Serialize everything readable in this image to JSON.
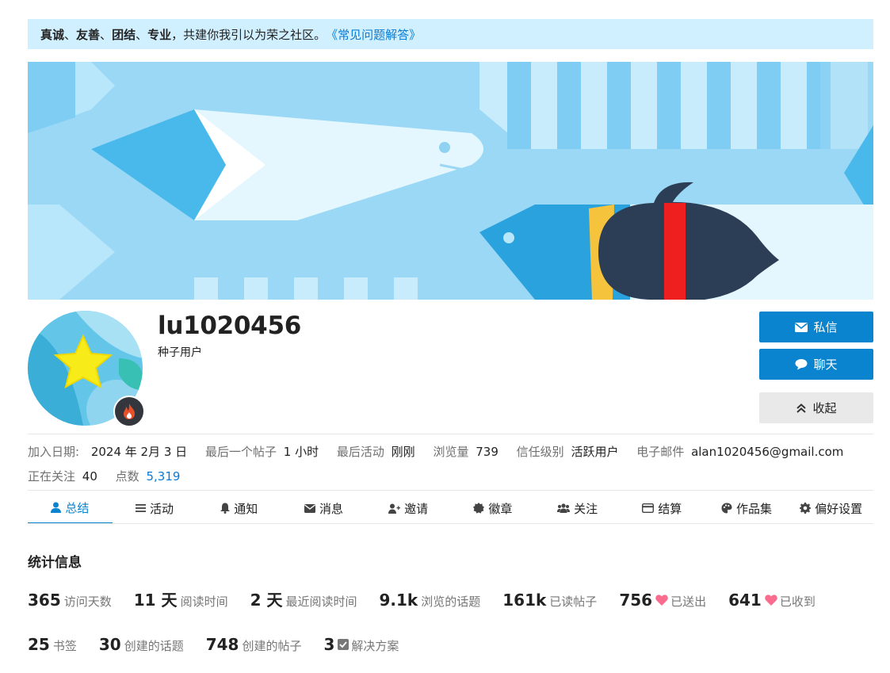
{
  "notice": {
    "bold1": "真诚",
    "sep1": "、",
    "bold2": "友善",
    "sep2": "、",
    "bold3": "团结",
    "sep3": "、",
    "bold4": "专业",
    "text": "，共建你我引以为荣之社区。",
    "link": "《常见问题解答》"
  },
  "profile": {
    "username": "lu1020456",
    "title": "种子用户",
    "flair_icon": "flame-icon"
  },
  "actions": {
    "message": "私信",
    "chat": "聊天",
    "collapse": "收起"
  },
  "meta": {
    "joined_label": "加入日期:",
    "joined_value": "2024 年 2月 3 日",
    "last_post_label": "最后一个帖子",
    "last_post_value": "1 小时",
    "last_active_label": "最后活动",
    "last_active_value": "刚刚",
    "views_label": "浏览量",
    "views_value": "739",
    "trust_label": "信任级别",
    "trust_value": "活跃用户",
    "email_label": "电子邮件",
    "email_value": "alan1020456@gmail.com",
    "following_label": "正在关注",
    "following_value": "40",
    "points_label": "点数",
    "points_value": "5,319"
  },
  "nav": [
    {
      "label": "总结",
      "icon": "user-icon",
      "active": true
    },
    {
      "label": "活动",
      "icon": "list-icon"
    },
    {
      "label": "通知",
      "icon": "bell-icon"
    },
    {
      "label": "消息",
      "icon": "envelope-icon"
    },
    {
      "label": "邀请",
      "icon": "user-plus-icon"
    },
    {
      "label": "徽章",
      "icon": "certificate-icon"
    },
    {
      "label": "关注",
      "icon": "users-icon"
    },
    {
      "label": "结算",
      "icon": "credit-card-icon"
    },
    {
      "label": "作品集",
      "icon": "palette-icon"
    },
    {
      "label": "偏好设置",
      "icon": "gear-icon"
    }
  ],
  "stats": {
    "title": "统计信息",
    "row1": [
      {
        "num": "365",
        "label": "访问天数"
      },
      {
        "num": "11 天",
        "label": "阅读时间"
      },
      {
        "num": "2 天",
        "label": "最近阅读时间"
      },
      {
        "num": "9.1k",
        "label": "浏览的话题"
      },
      {
        "num": "161k",
        "label": "已读帖子"
      },
      {
        "num": "756",
        "label": "已送出",
        "icon": "heart-icon"
      },
      {
        "num": "641",
        "label": "已收到",
        "icon": "heart-icon"
      }
    ],
    "row2": [
      {
        "num": "25",
        "label": "书签"
      },
      {
        "num": "30",
        "label": "创建的话题"
      },
      {
        "num": "748",
        "label": "创建的帖子"
      },
      {
        "num": "3",
        "label": "解决方案",
        "icon": "check-square-icon"
      }
    ]
  },
  "colors": {
    "accent": "#0a84cf",
    "notice_bg": "#d1f0ff",
    "heart": "#fa6c8d"
  }
}
